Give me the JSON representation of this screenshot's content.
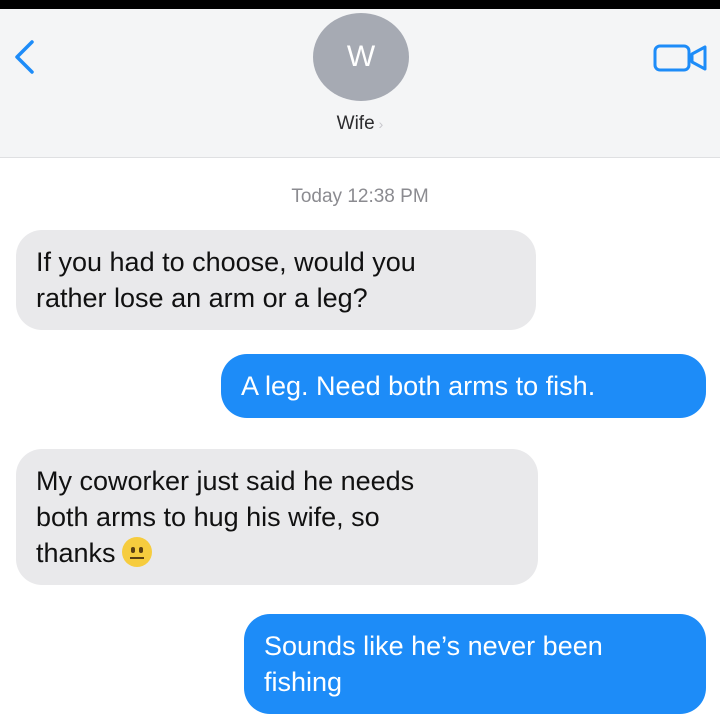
{
  "header": {
    "avatar_initial": "W",
    "contact_name": "Wife",
    "chevron": "›",
    "back_icon": "chevron-left-icon",
    "video_icon": "video-camera-icon",
    "accent_color": "#1d8cf8"
  },
  "thread": {
    "timestamp": "Today 12:38 PM",
    "messages": [
      {
        "direction": "incoming",
        "lines": [
          "If you had to choose, would you",
          "rather lose an arm or a leg?"
        ]
      },
      {
        "direction": "outgoing",
        "lines": [
          "A leg. Need both arms to fish."
        ]
      },
      {
        "direction": "incoming",
        "lines": [
          "My coworker just said he needs",
          "both arms to hug his wife, so",
          "thanks"
        ],
        "emoji": "neutral-face"
      },
      {
        "direction": "outgoing",
        "lines": [
          "Sounds like he’s never been",
          "fishing"
        ]
      }
    ]
  }
}
